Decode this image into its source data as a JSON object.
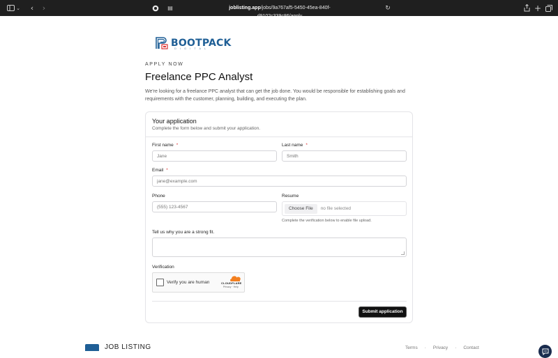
{
  "browser": {
    "url_host": "joblisting.app",
    "url_path": "/jobs/9a767af5-5450-45ea-840f-d9102c339c86/apply"
  },
  "brand": {
    "logo_text": "BOOTPACK",
    "logo_sub": "DIGITAL",
    "footer_logo": "JOB LISTING",
    "accent": "#1f5f96"
  },
  "header": {
    "eyebrow": "APPLY NOW",
    "title": "Freelance PPC Analyst",
    "description": "We're looking for a freelance PPC analyst that can get the job done. You would be responsible for establishing goals and requirements with the customer, planning, building, and executing the plan."
  },
  "form": {
    "title": "Your application",
    "subtitle": "Complete the form below and submit your application.",
    "first_name": {
      "label": "First name",
      "required": "*",
      "placeholder": "Jane"
    },
    "last_name": {
      "label": "Last name",
      "required": "*",
      "placeholder": "Smith"
    },
    "email": {
      "label": "Email",
      "required": "*",
      "placeholder": "jane@example.com"
    },
    "phone": {
      "label": "Phone",
      "placeholder": "(555) 123-4567"
    },
    "resume": {
      "label": "Resume",
      "button": "Choose File",
      "status": "no file selected",
      "hint": "Complete the verification below to enable file upload."
    },
    "fit": {
      "label": "Tell us why you are a strong fit."
    },
    "verification": {
      "label": "Verification",
      "checkbox_text": "Verify you are human",
      "provider": "CLOUDFLARE",
      "links": "Privacy · Help"
    },
    "submit_label": "Submit application"
  },
  "footer": {
    "links": [
      "Terms",
      "Privacy",
      "Contact"
    ],
    "separator": "·"
  }
}
